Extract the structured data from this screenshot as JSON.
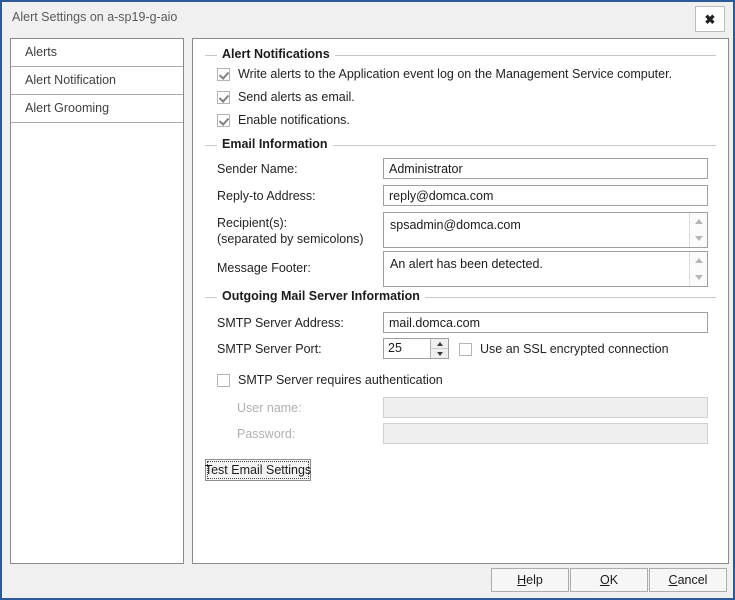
{
  "window": {
    "title": "Alert Settings on a-sp19-g-aio",
    "close_icon": "close-icon",
    "close_label": "✖"
  },
  "sidebar": {
    "items": [
      {
        "label": "Alerts"
      },
      {
        "label": "Alert Notification"
      },
      {
        "label": "Alert Grooming"
      }
    ]
  },
  "groups": {
    "alert_notifications": {
      "title": "Alert Notifications",
      "checkboxes": [
        {
          "label": "Write alerts to the Application event log on the Management Service computer.",
          "checked": true
        },
        {
          "label": "Send alerts as email.",
          "checked": true
        },
        {
          "label": "Enable  notifications.",
          "checked": true
        }
      ]
    },
    "email_information": {
      "title": "Email Information",
      "sender_name_label": "Sender Name:",
      "sender_name_value": "Administrator",
      "reply_to_label": "Reply-to Address:",
      "reply_to_value": "reply@domca.com",
      "recipients_label_line1": "Recipient(s):",
      "recipients_label_line2": "(separated by semicolons)",
      "recipients_value": "spsadmin@domca.com",
      "message_footer_label": "Message Footer:",
      "message_footer_value": "An alert has been detected."
    },
    "outgoing_mail": {
      "title": "Outgoing Mail Server Information",
      "smtp_address_label": "SMTP Server Address:",
      "smtp_address_value": "mail.domca.com",
      "smtp_port_label": "SMTP Server Port:",
      "smtp_port_value": "25",
      "ssl_label": "Use an SSL encrypted connection",
      "ssl_checked": false,
      "auth_label": "SMTP Server requires authentication",
      "auth_checked": false,
      "username_label": "User name:",
      "username_value": "",
      "password_label": "Password:",
      "password_value": "",
      "test_button_label": "Test Email Settings"
    }
  },
  "footer": {
    "help": "Help",
    "help_accel": "H",
    "ok": "OK",
    "ok_accel": "O",
    "cancel": "Cancel",
    "cancel_accel": "C"
  }
}
